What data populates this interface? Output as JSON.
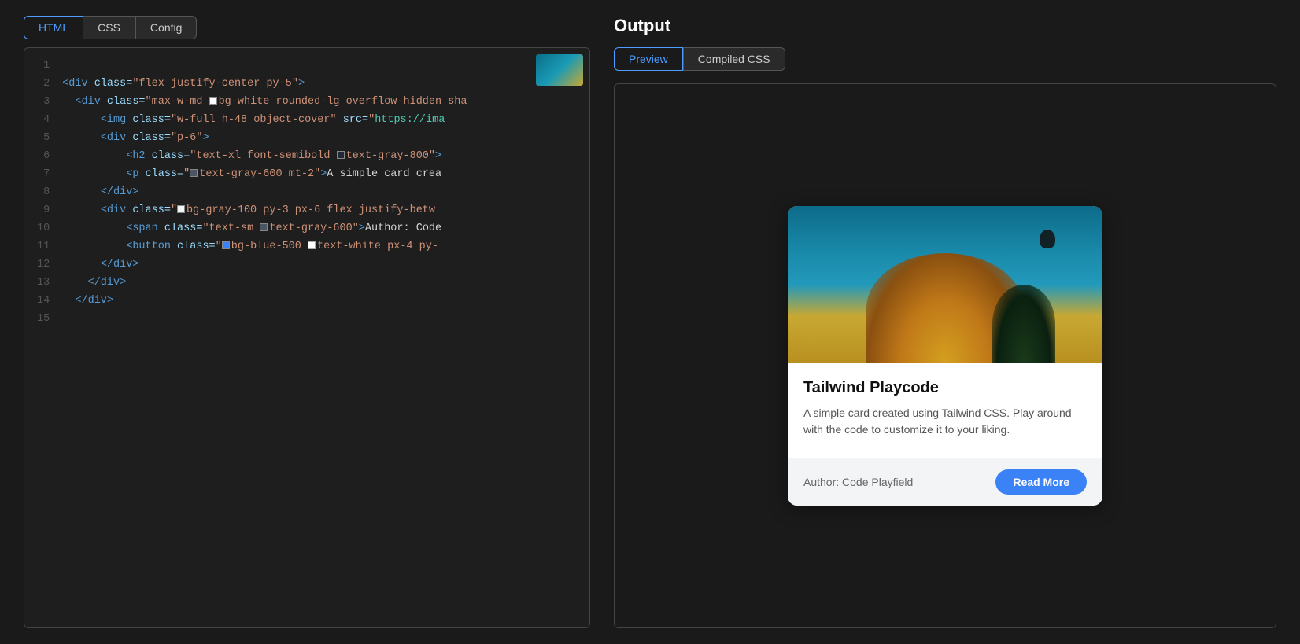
{
  "tabs": {
    "left": [
      {
        "id": "html",
        "label": "HTML",
        "active": true
      },
      {
        "id": "css",
        "label": "CSS",
        "active": false
      },
      {
        "id": "config",
        "label": "Config",
        "active": false
      }
    ],
    "right": [
      {
        "id": "preview",
        "label": "Preview",
        "active": true
      },
      {
        "id": "compiled-css",
        "label": "Compiled CSS",
        "active": false
      }
    ]
  },
  "output": {
    "title": "Output"
  },
  "code": {
    "lines": [
      {
        "num": 1,
        "content": ""
      },
      {
        "num": 2,
        "content": "<div class=\"flex justify-center py-5\">"
      },
      {
        "num": 3,
        "content": "  <div class=\"max-w-md bg-white rounded-lg overflow-hidden sha"
      },
      {
        "num": 4,
        "content": "      <img class=\"w-full h-48 object-cover\" src=\"https://ima"
      },
      {
        "num": 5,
        "content": "      <div class=\"p-6\">"
      },
      {
        "num": 6,
        "content": "          <h2 class=\"text-xl font-semibold text-gray-800\">"
      },
      {
        "num": 7,
        "content": "          <p class=\"text-gray-600 mt-2\">A simple card crea"
      },
      {
        "num": 8,
        "content": "      </div>"
      },
      {
        "num": 9,
        "content": "      <div class=\"bg-gray-100 py-3 px-6 flex justify-betw"
      },
      {
        "num": 10,
        "content": "          <span class=\"text-sm text-gray-600\">Author: Code"
      },
      {
        "num": 11,
        "content": "          <button class=\"bg-blue-500 text-white px-4 py-"
      },
      {
        "num": 12,
        "content": "      </div>"
      },
      {
        "num": 13,
        "content": "  </div>"
      },
      {
        "num": 14,
        "content": "</div>"
      },
      {
        "num": 15,
        "content": ""
      }
    ]
  },
  "card": {
    "title": "Tailwind Playcode",
    "description": "A simple card created using Tailwind CSS. Play around with the code to customize it to your liking.",
    "author_label": "Author: Code Playfield",
    "read_more_label": "Read More"
  }
}
